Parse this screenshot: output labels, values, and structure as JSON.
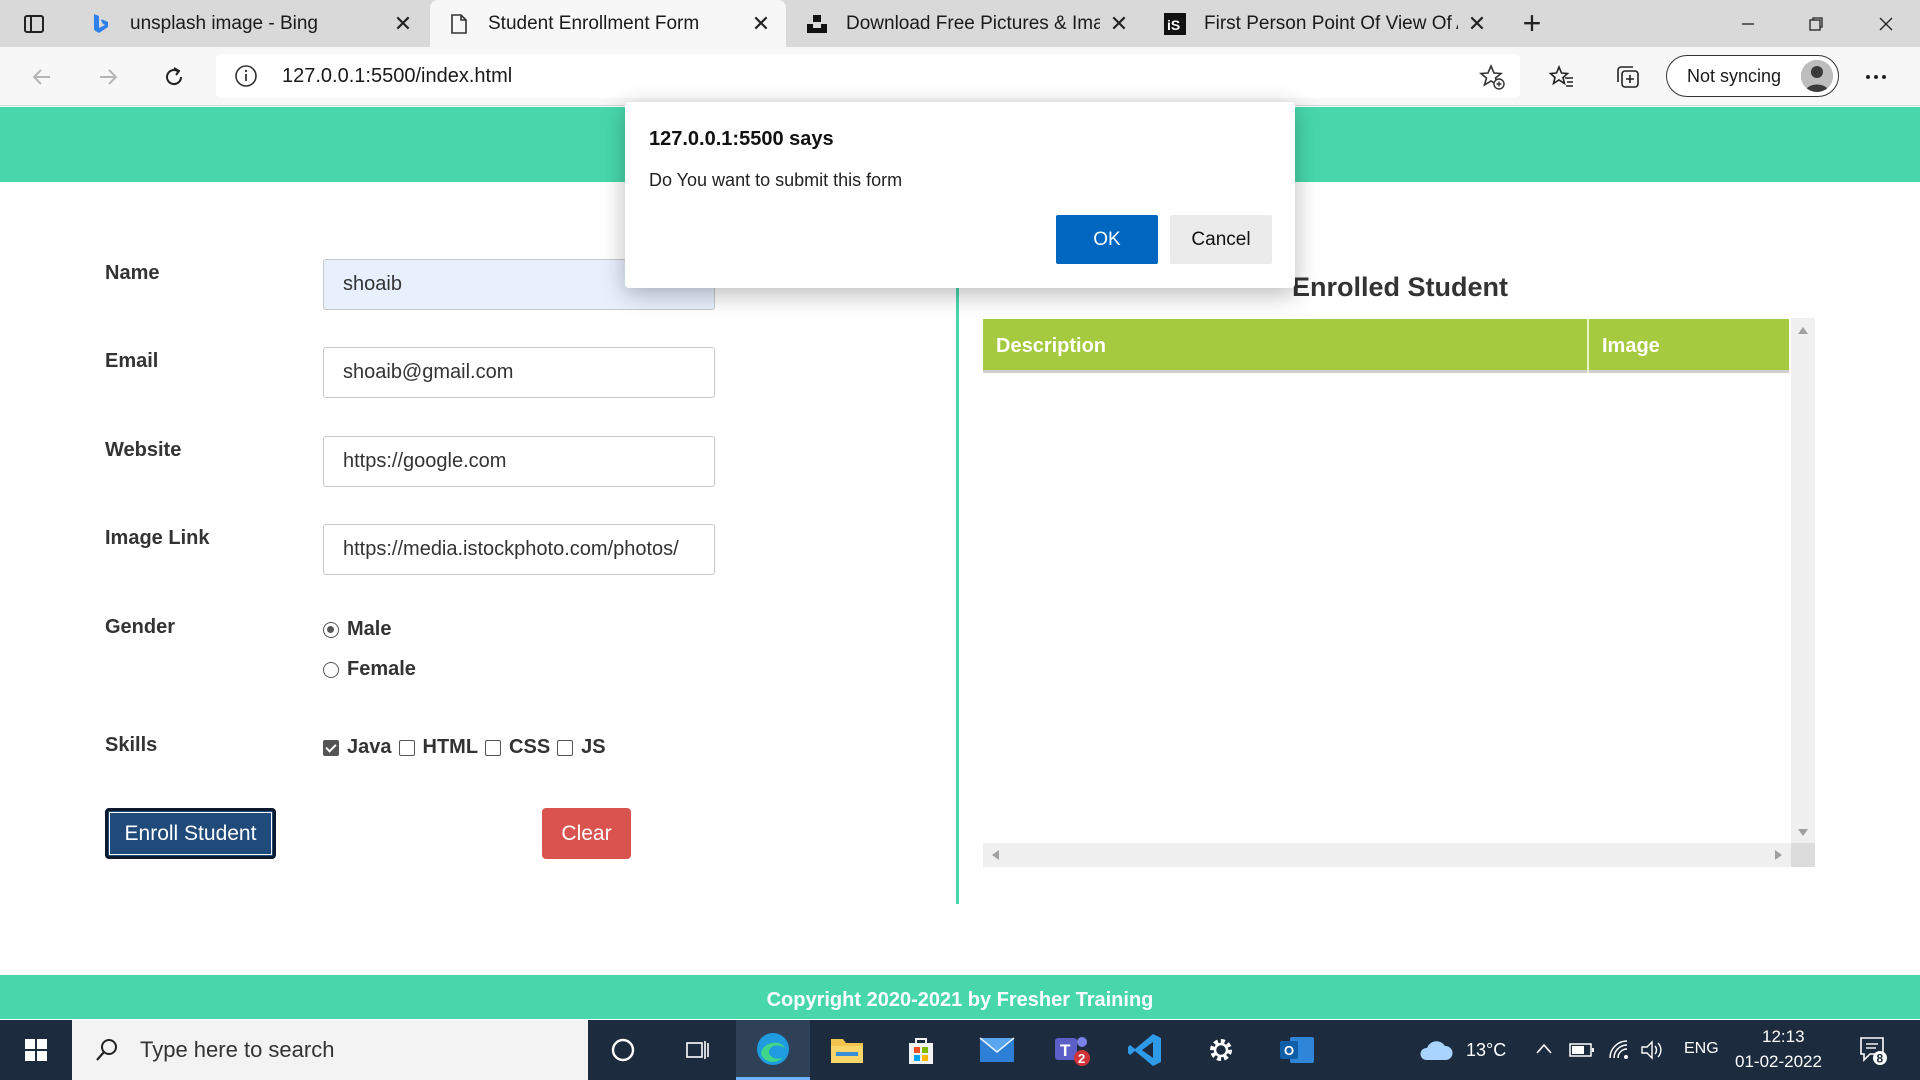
{
  "browser": {
    "tabs": [
      {
        "title": "unsplash image - Bing",
        "favicon": "bing-icon",
        "active": false
      },
      {
        "title": "Student Enrollment Form",
        "favicon": "page-icon",
        "active": true
      },
      {
        "title": "Download Free Pictures & Images",
        "favicon": "unsplash-icon",
        "active": false
      },
      {
        "title": "First Person Point Of View Of A W",
        "favicon": "istock-icon",
        "active": false
      }
    ],
    "url": "127.0.0.1:5500/index.html",
    "sync_label": "Not syncing"
  },
  "dialog": {
    "title": "127.0.0.1:5500 says",
    "message": "Do You want to submit this form",
    "ok_label": "OK",
    "cancel_label": "Cancel"
  },
  "form": {
    "name_label": "Name",
    "name_value": "shoaib",
    "email_label": "Email",
    "email_value": "shoaib@gmail.com",
    "website_label": "Website",
    "website_value": "https://google.com",
    "image_label": "Image Link",
    "image_value": "https://media.istockphoto.com/photos/",
    "gender_label": "Gender",
    "gender_options": [
      "Male",
      "Female"
    ],
    "gender_selected": "Male",
    "skills_label": "Skills",
    "skills": [
      {
        "label": "Java",
        "checked": true
      },
      {
        "label": "HTML",
        "checked": false
      },
      {
        "label": "CSS",
        "checked": false
      },
      {
        "label": "JS",
        "checked": false
      }
    ],
    "enroll_label": "Enroll Student",
    "clear_label": "Clear"
  },
  "table": {
    "title": "Enrolled Student",
    "columns": [
      "Description",
      "Image"
    ]
  },
  "footer": {
    "text": "Copyright 2020-2021 by Fresher Training"
  },
  "taskbar": {
    "search_placeholder": "Type here to search",
    "temperature": "13°C",
    "language": "ENG",
    "time": "12:13",
    "date": "01-02-2022",
    "teams_badge": "2",
    "notification_count": "8"
  },
  "colors": {
    "accent_teal": "#48d7ab",
    "table_header_green": "#a5c93f",
    "enroll_button": "#1f4a7a",
    "clear_button": "#d9534f",
    "dialog_ok": "#0067c0"
  }
}
